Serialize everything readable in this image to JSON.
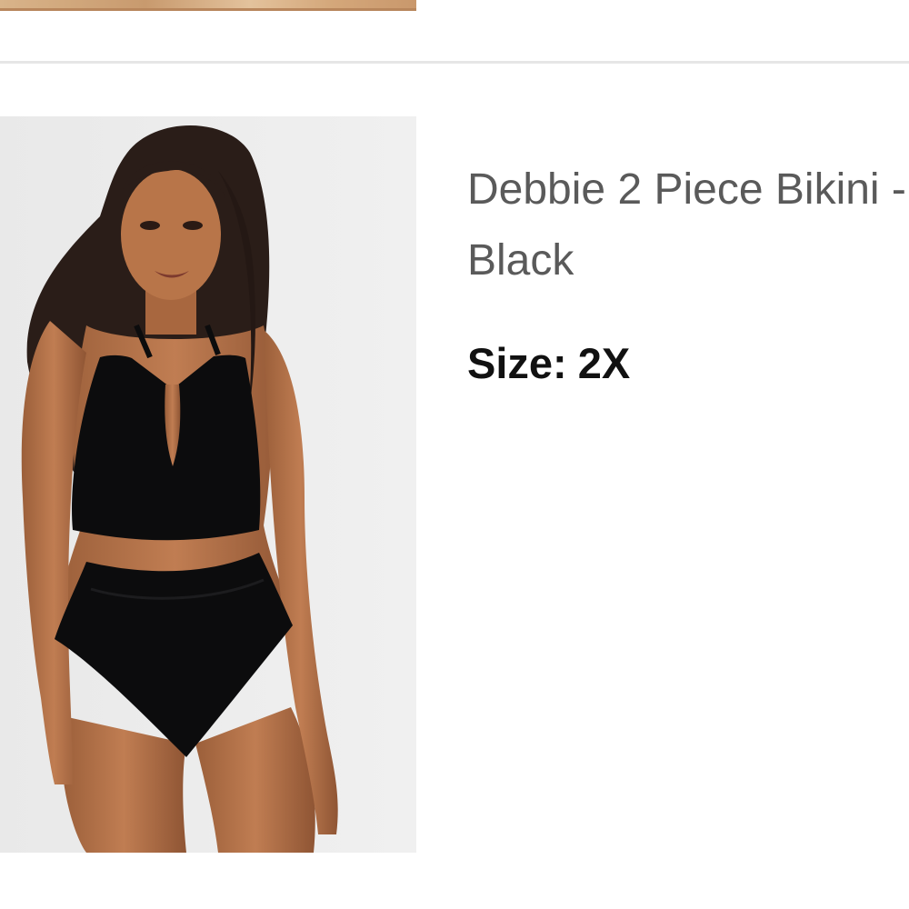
{
  "product": {
    "title": "Debbie 2 Piece Bikini - Black",
    "size_label": "Size:",
    "size_value": "2X"
  },
  "colors": {
    "title_text": "#5a5a5a",
    "size_text": "#111111",
    "image_background": "#ececec",
    "divider": "#e6e6e6"
  }
}
